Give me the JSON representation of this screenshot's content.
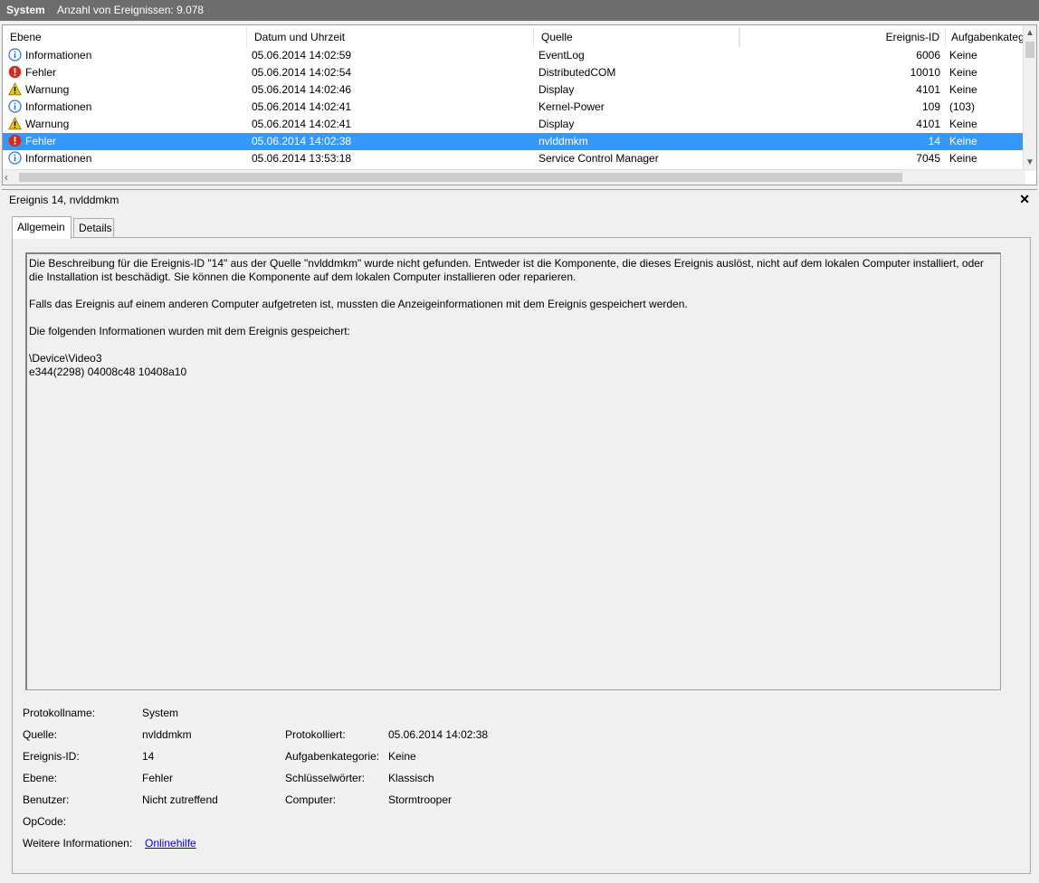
{
  "window": {
    "title": "System",
    "event_count_label": "Anzahl von Ereignissen: 9.078"
  },
  "list": {
    "columns": {
      "level": "Ebene",
      "datetime": "Datum und Uhrzeit",
      "source": "Quelle",
      "event_id": "Ereignis-ID",
      "task_category": "Aufgabenkateg"
    },
    "rows": [
      {
        "icon": "info",
        "level": "Informationen",
        "datetime": "05.06.2014 14:02:59",
        "source": "EventLog",
        "event_id": "6006",
        "task_category": "Keine",
        "selected": false
      },
      {
        "icon": "error",
        "level": "Fehler",
        "datetime": "05.06.2014 14:02:54",
        "source": "DistributedCOM",
        "event_id": "10010",
        "task_category": "Keine",
        "selected": false
      },
      {
        "icon": "warning",
        "level": "Warnung",
        "datetime": "05.06.2014 14:02:46",
        "source": "Display",
        "event_id": "4101",
        "task_category": "Keine",
        "selected": false
      },
      {
        "icon": "info",
        "level": "Informationen",
        "datetime": "05.06.2014 14:02:41",
        "source": "Kernel-Power",
        "event_id": "109",
        "task_category": "(103)",
        "selected": false
      },
      {
        "icon": "warning",
        "level": "Warnung",
        "datetime": "05.06.2014 14:02:41",
        "source": "Display",
        "event_id": "4101",
        "task_category": "Keine",
        "selected": false
      },
      {
        "icon": "error",
        "level": "Fehler",
        "datetime": "05.06.2014 14:02:38",
        "source": "nvlddmkm",
        "event_id": "14",
        "task_category": "Keine",
        "selected": true
      },
      {
        "icon": "info",
        "level": "Informationen",
        "datetime": "05.06.2014 13:53:18",
        "source": "Service Control Manager",
        "event_id": "7045",
        "task_category": "Keine",
        "selected": false
      }
    ]
  },
  "detail": {
    "title": "Ereignis 14, nvlddmkm",
    "close_glyph": "✕",
    "tabs": [
      {
        "label": "Allgemein",
        "active": true
      },
      {
        "label": "Details",
        "active": false
      }
    ],
    "description": {
      "paragraph1": "Die Beschreibung für die Ereignis-ID \"14\" aus der Quelle \"nvlddmkm\" wurde nicht gefunden. Entweder ist die Komponente, die dieses Ereignis auslöst, nicht auf dem lokalen Computer installiert, oder die Installation ist beschädigt. Sie können die Komponente auf dem lokalen Computer installieren oder reparieren.",
      "paragraph2": "Falls das Ereignis auf einem anderen Computer aufgetreten ist, mussten die Anzeigeinformationen mit dem Ereignis gespeichert werden.",
      "paragraph3": "Die folgenden Informationen wurden mit dem Ereignis gespeichert:",
      "raw_line1": "\\Device\\Video3",
      "raw_line2": "e344(2298) 04008c48 10408a10"
    },
    "fields": {
      "log_name_label": "Protokollname:",
      "log_name": "System",
      "source_label": "Quelle:",
      "source": "nvlddmkm",
      "logged_label": "Protokolliert:",
      "logged": "05.06.2014 14:02:38",
      "event_id_label": "Ereignis-ID:",
      "event_id": "14",
      "task_category_label": "Aufgabenkategorie:",
      "task_category": "Keine",
      "level_label": "Ebene:",
      "level": "Fehler",
      "keywords_label": "Schlüsselwörter:",
      "keywords": "Klassisch",
      "user_label": "Benutzer:",
      "user": "Nicht zutreffend",
      "computer_label": "Computer:",
      "computer": "Stormtrooper",
      "opcode_label": "OpCode:",
      "more_info_label": "Weitere Informationen:",
      "more_info_link": "Onlinehilfe"
    }
  },
  "colors": {
    "selection": "#3399ff",
    "titlebar": "#6d6d6d",
    "link": "#0000ee",
    "info_icon": "#2a6fd6",
    "error_icon": "#d52b1e",
    "warning_icon": "#f5c400"
  }
}
